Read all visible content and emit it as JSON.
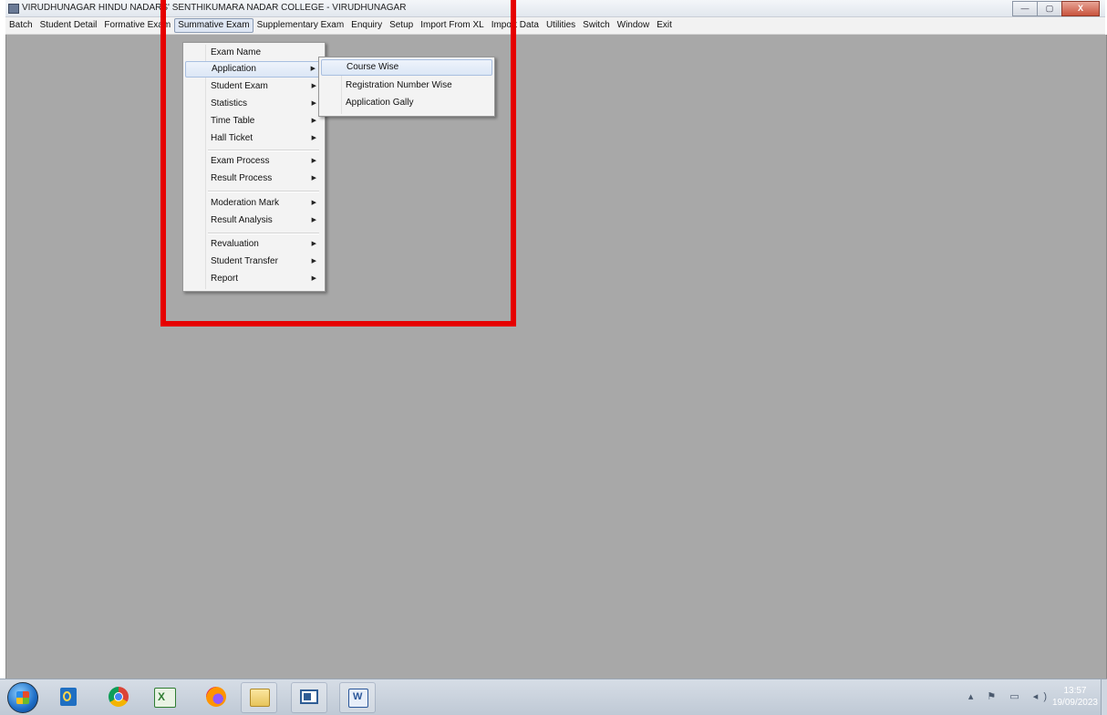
{
  "window": {
    "title": "VIRUDHUNAGAR HINDU NADARS' SENTHIKUMARA NADAR COLLEGE - VIRUDHUNAGAR",
    "controls": {
      "minimize": "—",
      "maximize": "▢",
      "close": "X"
    }
  },
  "menubar": {
    "items": [
      {
        "label": "Batch"
      },
      {
        "label": "Student Detail"
      },
      {
        "label": "Formative Exam"
      },
      {
        "label": "Summative Exam",
        "active": true
      },
      {
        "label": "Supplementary Exam"
      },
      {
        "label": "Enquiry"
      },
      {
        "label": "Setup"
      },
      {
        "label": "Import From XL"
      },
      {
        "label": "Import Data"
      },
      {
        "label": "Utilities"
      },
      {
        "label": "Switch"
      },
      {
        "label": "Window"
      },
      {
        "label": "Exit"
      }
    ]
  },
  "dropdown": {
    "items": [
      {
        "label": "Exam Name",
        "submenu": false
      },
      {
        "label": "Application",
        "submenu": true,
        "highlighted": true
      },
      {
        "label": "Student Exam",
        "submenu": true
      },
      {
        "label": "Statistics",
        "submenu": true
      },
      {
        "label": "Time Table",
        "submenu": true
      },
      {
        "label": "Hall Ticket",
        "submenu": true
      },
      {
        "label": "Exam Process",
        "submenu": true
      },
      {
        "label": "Result Process",
        "submenu": true
      },
      {
        "label": "Moderation Mark",
        "submenu": true
      },
      {
        "label": "Result Analysis",
        "submenu": true
      },
      {
        "label": "Revaluation",
        "submenu": true
      },
      {
        "label": "Student Transfer",
        "submenu": true
      },
      {
        "label": "Report",
        "submenu": true
      }
    ],
    "arrow": "▶"
  },
  "submenu": {
    "items": [
      {
        "label": "Course Wise",
        "highlighted": true
      },
      {
        "label": "Registration Number Wise"
      },
      {
        "label": "Application Gally"
      }
    ]
  },
  "taskbar": {
    "icons": [
      "outlook-icon",
      "chrome-icon",
      "excel-icon",
      "firefox-icon",
      "file-explorer-icon",
      "app-window-icon",
      "word-icon"
    ],
    "clock": {
      "time": "13:57",
      "date": "19/09/2023"
    }
  },
  "colors": {
    "highlight_box": "#e60000",
    "workspace": "#a8a8a8"
  }
}
